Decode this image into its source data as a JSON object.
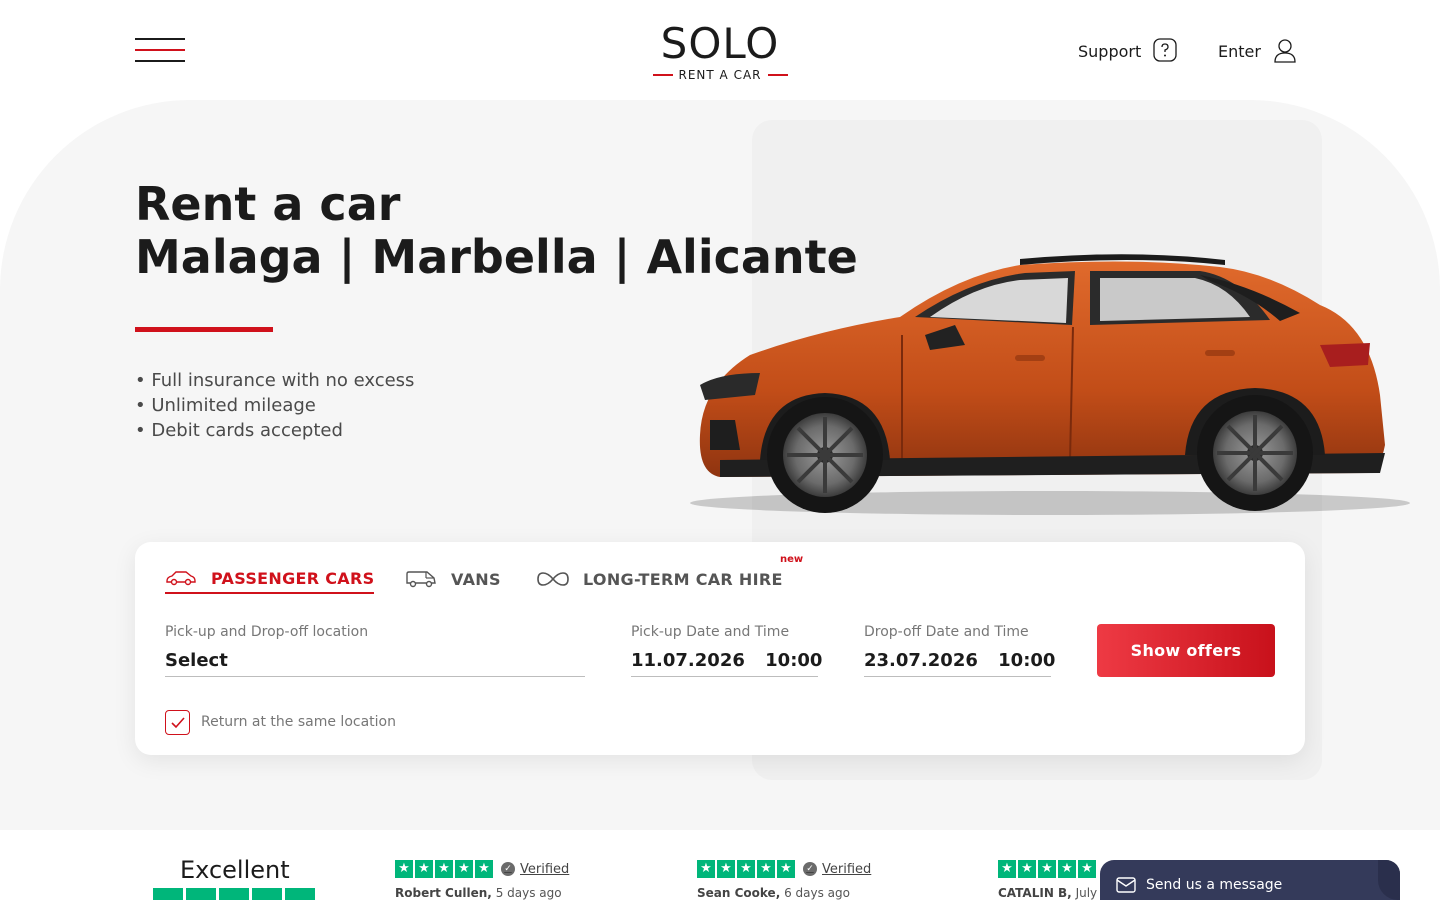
{
  "header": {
    "logo_word": "SOLO",
    "logo_sub": "RENT A CAR",
    "support_label": "Support",
    "enter_label": "Enter"
  },
  "hero": {
    "title_line1": "Rent a car",
    "title_line2": "Malaga | Marbella | Alicante",
    "features": [
      "• Full insurance with no excess",
      "• Unlimited mileage",
      "• Debit cards accepted"
    ]
  },
  "booking": {
    "tabs": [
      {
        "label": "PASSENGER CARS",
        "icon": "car-icon",
        "active": true
      },
      {
        "label": "VANS",
        "icon": "van-icon",
        "active": false
      },
      {
        "label": "LONG-TERM CAR HIRE",
        "icon": "infinity-icon",
        "active": false
      }
    ],
    "new_badge": "new",
    "location_label": "Pick-up and Drop-off location",
    "location_value": "Select",
    "pickup_label": "Pick-up Date and Time",
    "pickup_date": "11.07.2026",
    "pickup_time": "10:00",
    "dropoff_label": "Drop-off Date and Time",
    "dropoff_date": "23.07.2026",
    "dropoff_time": "10:00",
    "submit_label": "Show offers",
    "same_location_label": "Return at the same location",
    "same_location_checked": true
  },
  "reviews": {
    "summary": "Excellent",
    "verified_label": "Verified",
    "items": [
      {
        "author": "Robert Cullen,",
        "when": "5 days ago",
        "stars": 5
      },
      {
        "author": "Sean Cooke,",
        "when": "6 days ago",
        "stars": 5
      },
      {
        "author": "CATALIN B,",
        "when": "July",
        "stars": 5
      }
    ]
  },
  "chat": {
    "label": "Send us a message"
  },
  "colors": {
    "accent": "#d0111b",
    "trustpilot": "#00b67a",
    "chat_bg": "#343a5a",
    "car": "#c9521d"
  }
}
